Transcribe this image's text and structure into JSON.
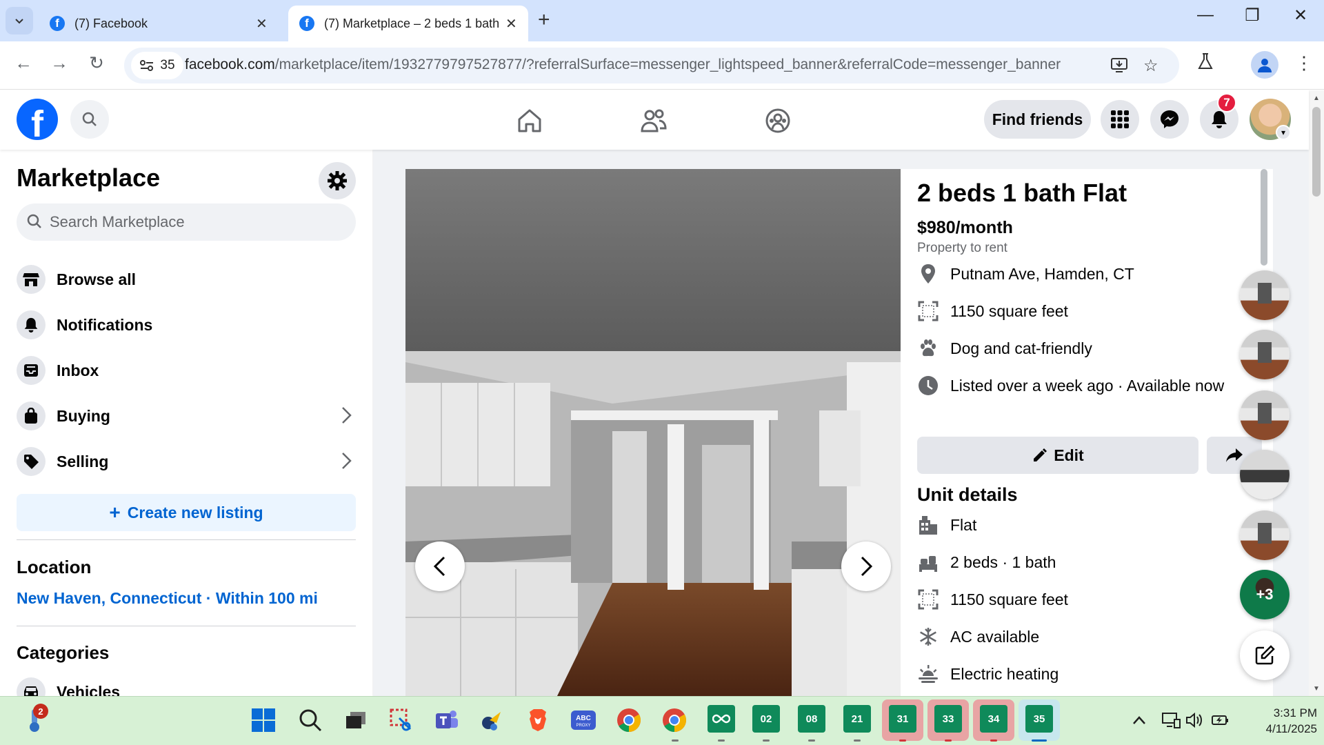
{
  "browser": {
    "tabs": [
      {
        "title": "(7) Facebook"
      },
      {
        "title": "(7) Marketplace – 2 beds 1 bath"
      }
    ],
    "site_info_count": "35",
    "url_host": "facebook.com",
    "url_path": "/marketplace/item/1932779797527877/?referralSurface=messenger_lightspeed_banner&referralCode=messenger_banner"
  },
  "header": {
    "find_friends_label": "Find friends",
    "notification_count": "7"
  },
  "sidebar": {
    "title": "Marketplace",
    "search_placeholder": "Search Marketplace",
    "items": [
      {
        "label": "Browse all"
      },
      {
        "label": "Notifications"
      },
      {
        "label": "Inbox"
      },
      {
        "label": "Buying"
      },
      {
        "label": "Selling"
      }
    ],
    "create_label": "Create new listing",
    "location_heading": "Location",
    "location_value": "New Haven, Connecticut · Within 100 mi",
    "categories_heading": "Categories",
    "categories": [
      {
        "label": "Vehicles"
      }
    ]
  },
  "listing": {
    "title": "2 beds 1 bath Flat",
    "price": "$980/month",
    "type": "Property to rent",
    "info": [
      {
        "text": "Putnam Ave, Hamden, CT",
        "icon": "location-pin-icon"
      },
      {
        "text": "1150 square feet",
        "icon": "area-icon"
      },
      {
        "text": "Dog and cat-friendly",
        "icon": "paw-icon"
      },
      {
        "text": "Listed over a week ago · Available now",
        "icon": "clock-icon"
      }
    ],
    "edit_label": "Edit",
    "unit_details_heading": "Unit details",
    "unit_details": [
      {
        "text": "Flat",
        "icon": "building-icon"
      },
      {
        "text": "2 beds · 1 bath",
        "icon": "bed-icon"
      },
      {
        "text": "1150 square feet",
        "icon": "area-icon"
      },
      {
        "text": "AC available",
        "icon": "snowflake-icon"
      },
      {
        "text": "Electric heating",
        "icon": "heating-icon"
      }
    ]
  },
  "chat_bubbles": {
    "more_count": "+3"
  },
  "taskbar": {
    "weather_badge": "2",
    "sheet_apps": [
      "02",
      "08",
      "21",
      "31",
      "33",
      "34",
      "35"
    ],
    "time": "3:31 PM",
    "date": "4/11/2025"
  },
  "colors": {
    "facebook_blue": "#0866ff",
    "link_blue": "#0064d1",
    "badge_red": "#e41e3f",
    "tab_strip": "#d3e3fd"
  }
}
